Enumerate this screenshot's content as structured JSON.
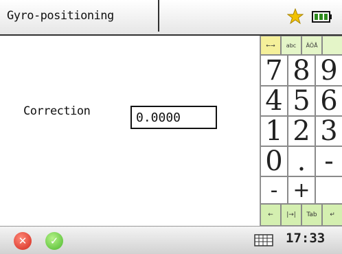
{
  "header": {
    "title": "Gyro-positioning",
    "star_icon": "star-icon",
    "battery_icon": "battery-icon"
  },
  "form": {
    "correction_label": "Correction",
    "correction_value": "0.0000"
  },
  "keypad": {
    "modes": [
      "←→",
      "abc",
      "ÄÖÅ"
    ],
    "digits_row1": [
      "7",
      "8",
      "9"
    ],
    "digits_row2": [
      "4",
      "5",
      "6"
    ],
    "digits_row3": [
      "1",
      "2",
      "3"
    ],
    "row4": [
      "0",
      ".",
      "-"
    ],
    "row5": [
      "-",
      "+"
    ],
    "bottom": [
      "←",
      "|→|",
      "Tab",
      "↵"
    ]
  },
  "status": {
    "cancel_icon": "cancel-icon",
    "ok_icon": "ok-icon",
    "keyboard_icon": "keyboard-icon",
    "time": "17:33"
  },
  "colors": {
    "mode_active": "#f5f09a",
    "bottom_keys": "#d4efb0",
    "cancel": "#d2261a",
    "ok": "#4ab82a",
    "star": "#f2c200"
  }
}
